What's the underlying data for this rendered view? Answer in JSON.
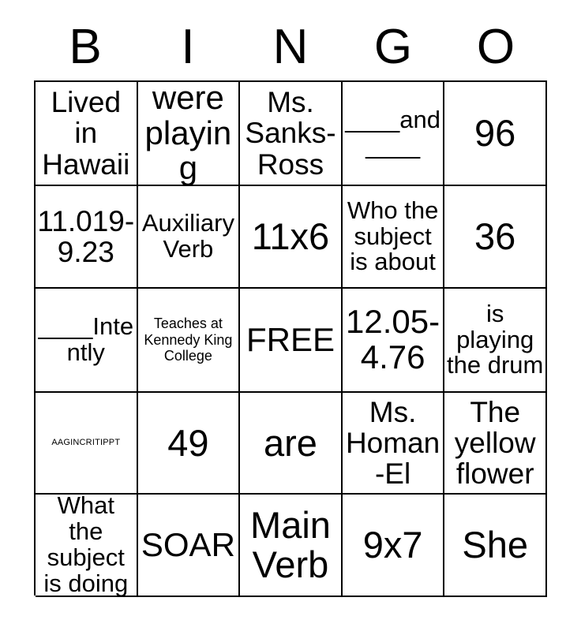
{
  "card": {
    "header_letters": [
      "B",
      "I",
      "N",
      "G",
      "O"
    ],
    "free_space_label": "FREE",
    "rows": [
      [
        {
          "text": "Lived in Hawaii",
          "size": "lg"
        },
        {
          "text": "were playing",
          "size": "xl"
        },
        {
          "text": "Ms. Sanks-Ross",
          "size": "lg"
        },
        {
          "text": "____and ____",
          "size": "md"
        },
        {
          "text": "96",
          "size": "xxl"
        }
      ],
      [
        {
          "text": "11.019-9.23",
          "size": "lg"
        },
        {
          "text": "Auxiliary Verb",
          "size": "md"
        },
        {
          "text": "11x6",
          "size": "xxl"
        },
        {
          "text": "Who the subject is about",
          "size": "md"
        },
        {
          "text": "36",
          "size": "xxl"
        }
      ],
      [
        {
          "text": "____Intently",
          "size": "md"
        },
        {
          "text": "Teaches at Kennedy King College",
          "size": "xs"
        },
        {
          "text": "FREE",
          "size": "xl"
        },
        {
          "text": "12.05-4.76",
          "size": "xl"
        },
        {
          "text": "is playing the drum",
          "size": "md"
        }
      ],
      [
        {
          "text": "AAGINCRITIPPT",
          "size": "xxs"
        },
        {
          "text": "49",
          "size": "xxl"
        },
        {
          "text": "are",
          "size": "xxl"
        },
        {
          "text": "Ms. Homan-El",
          "size": "lg"
        },
        {
          "text": "The yellow flower",
          "size": "lg"
        }
      ],
      [
        {
          "text": "What the subject is doing",
          "size": "md"
        },
        {
          "text": "SOAR",
          "size": "xl"
        },
        {
          "text": "Main Verb",
          "size": "xxl"
        },
        {
          "text": "9x7",
          "size": "xxl"
        },
        {
          "text": "She",
          "size": "xxl"
        }
      ]
    ]
  },
  "colors": {
    "background": "#ffffff",
    "text": "#000000",
    "grid_line": "#000000"
  }
}
